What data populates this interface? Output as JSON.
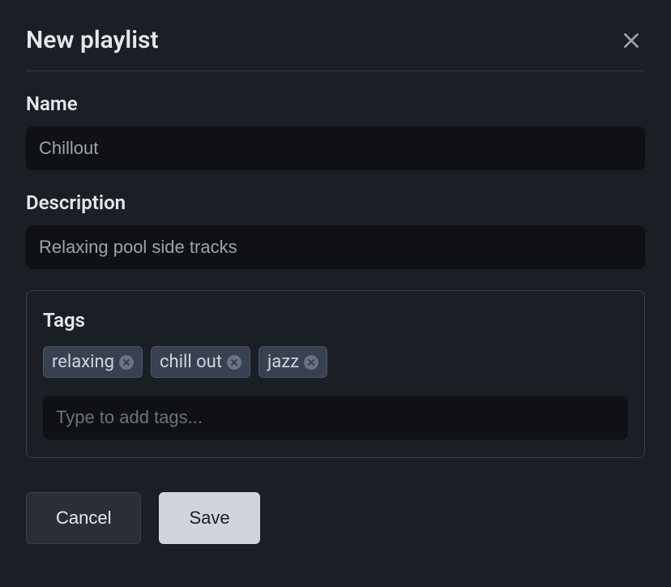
{
  "dialog": {
    "title": "New playlist"
  },
  "fields": {
    "name": {
      "label": "Name",
      "value": "Chillout"
    },
    "description": {
      "label": "Description",
      "value": "Relaxing pool side tracks"
    },
    "tags": {
      "label": "Tags",
      "items": [
        "relaxing",
        "chill out",
        "jazz"
      ],
      "placeholder": "Type to add tags..."
    }
  },
  "actions": {
    "cancel": "Cancel",
    "save": "Save"
  }
}
